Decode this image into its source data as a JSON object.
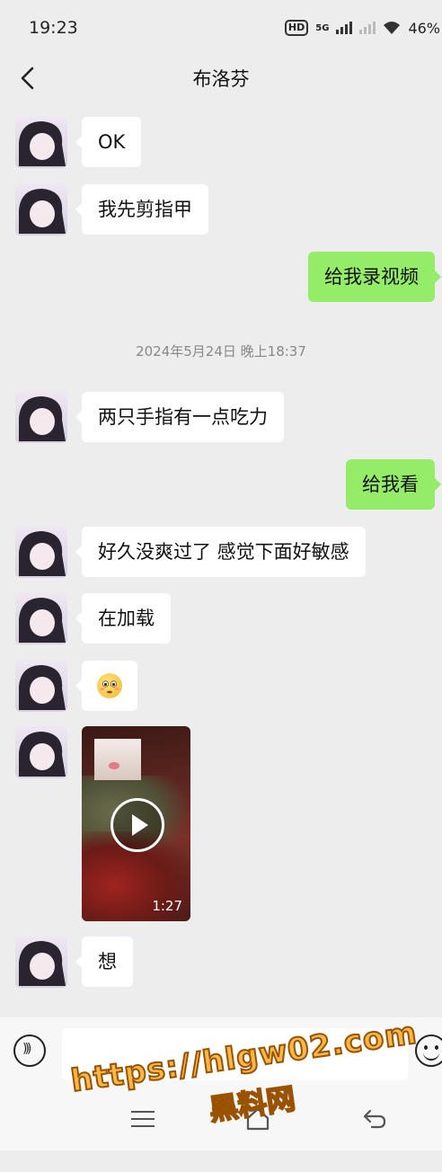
{
  "status_bar": {
    "time": "19:23",
    "hd_label": "HD",
    "network_label": "5G",
    "battery": "46%"
  },
  "header": {
    "title": "布洛芬",
    "back_icon": "chevron-left-icon"
  },
  "messages": [
    {
      "side": "left",
      "type": "text",
      "text": "OK"
    },
    {
      "side": "left",
      "type": "text",
      "text": "我先剪指甲"
    },
    {
      "side": "right",
      "type": "text",
      "text": "给我录视频"
    },
    {
      "type": "timestamp",
      "text": "2024年5月24日 晚上18:37"
    },
    {
      "side": "left",
      "type": "text",
      "text": "两只手指有一点吃力"
    },
    {
      "side": "right",
      "type": "text",
      "text": "给我看"
    },
    {
      "side": "left",
      "type": "text",
      "text": "好久没爽过了 感觉下面好敏感"
    },
    {
      "side": "left",
      "type": "text",
      "text": "在加载"
    },
    {
      "side": "left",
      "type": "emoji",
      "emoji": "flushed-face-emoji"
    },
    {
      "side": "left",
      "type": "video",
      "duration": "1:27"
    },
    {
      "side": "left",
      "type": "text",
      "text": "想"
    }
  ],
  "input_bar": {
    "voice_icon": "voice-icon",
    "emoji_icon": "emoji-icon",
    "text_value": ""
  },
  "nav_bar": {
    "menu_icon": "menu-icon",
    "home_icon": "home-icon",
    "back_icon": "back-icon"
  },
  "watermark": {
    "url": "https://hlgw02.com",
    "name": "黑料网"
  },
  "colors": {
    "background": "#ededed",
    "sent_bubble": "#95ec69",
    "received_bubble": "#ffffff"
  }
}
